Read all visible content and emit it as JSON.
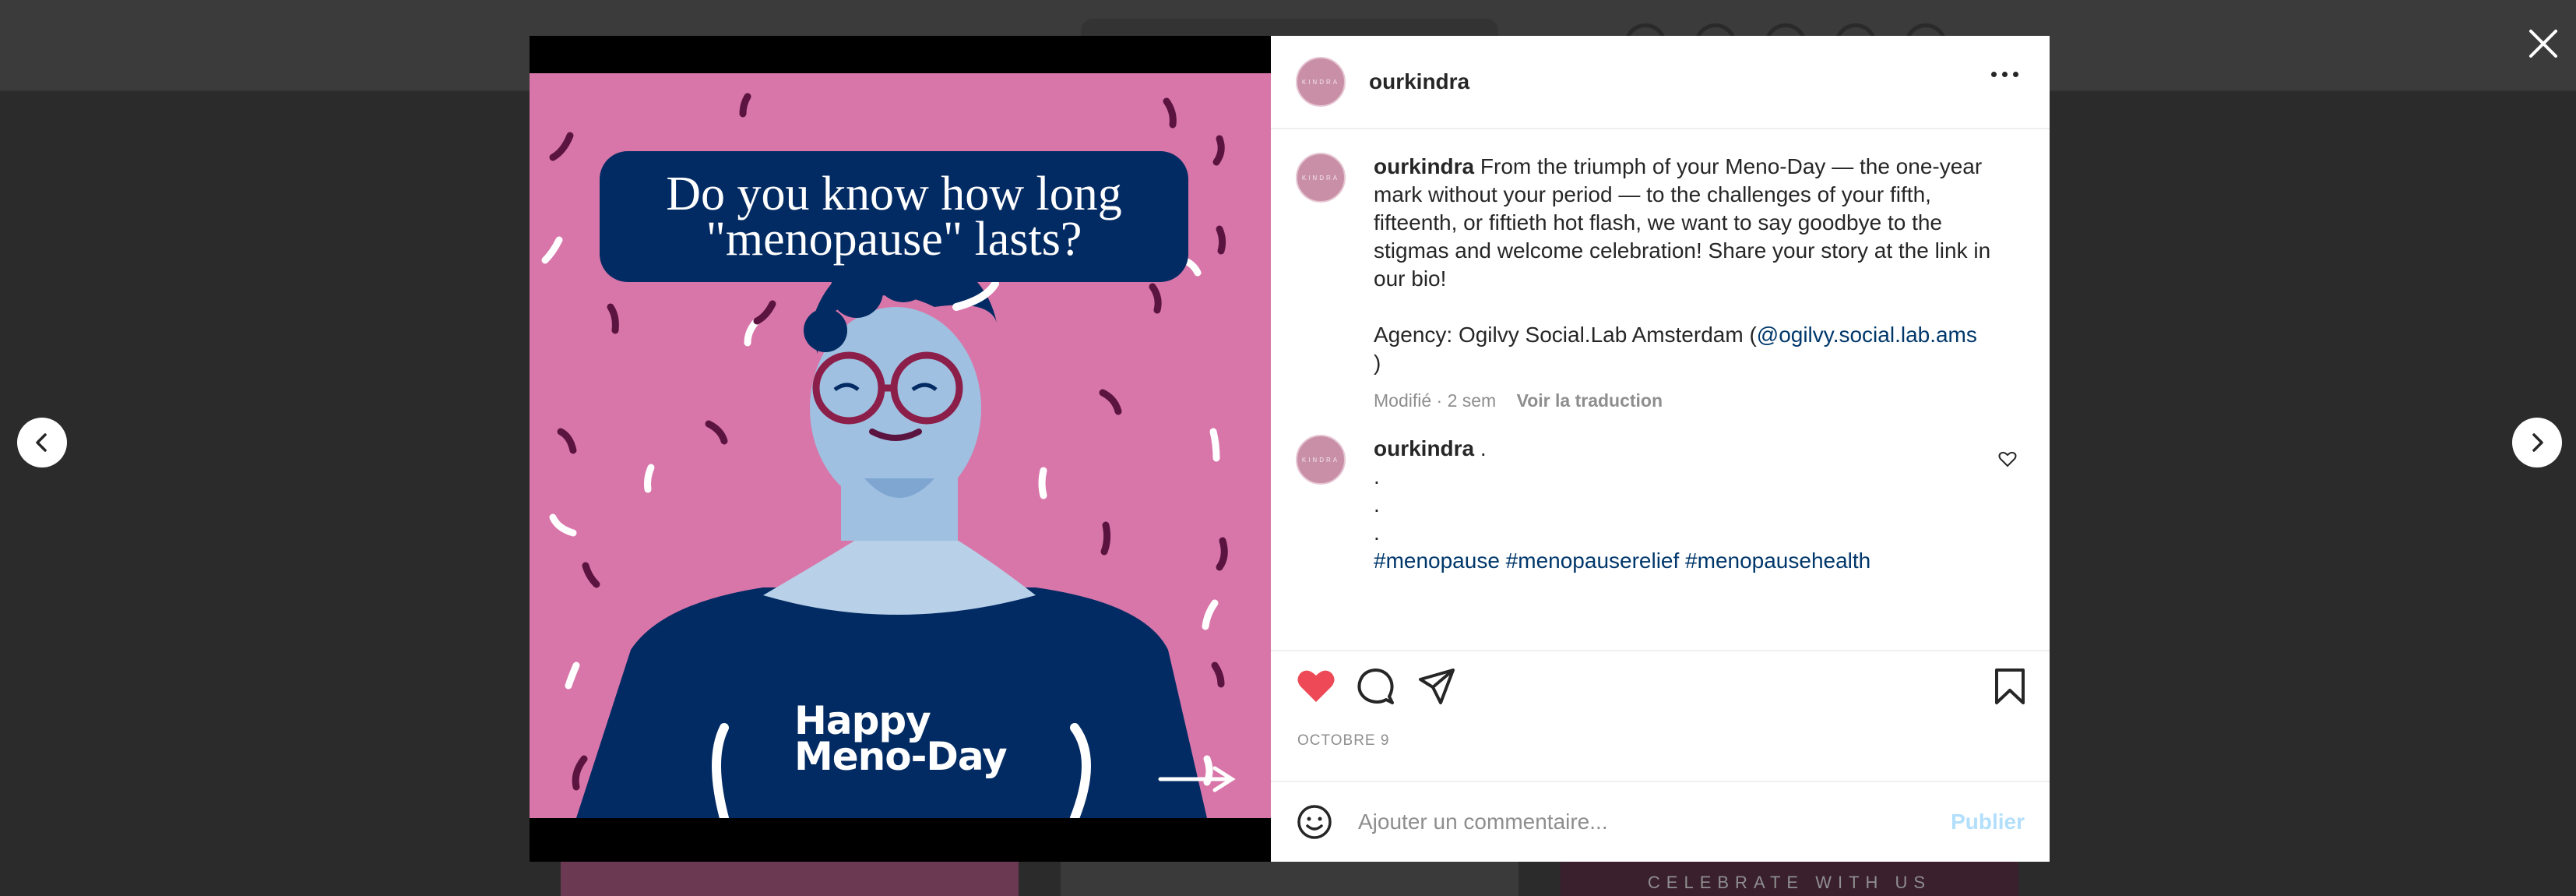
{
  "background": {
    "tile_caption": "CELEBRATE WITH US"
  },
  "post": {
    "headline": "Do you know how long\n\"menopause\" lasts?",
    "shirt_text": "Happy\nMeno-Day",
    "colors": {
      "art_background": "#d876a9",
      "bubble": "#032b63",
      "like_red": "#ed4956",
      "link": "#00376b"
    }
  },
  "panel": {
    "username": "ourkindra",
    "avatar_text": "KINDRA",
    "caption": {
      "username": "ourkindra",
      "text": "From the triumph of your Meno-Day — the one-year mark without your period — to the challenges of your fifth, fifteenth, or fiftieth hot flash, we want to say goodbye to the stigmas and welcome celebration! Share your story at the link in our bio!",
      "agency_prefix": "Agency: Ogilvy Social.Lab Amsterdam (",
      "agency_handle": "@ogilvy.social.lab.ams",
      "agency_suffix": ")",
      "edited": "Modifié · 2 sem",
      "translate": "Voir la traduction"
    },
    "comment": {
      "username": "ourkindra",
      "first_line": ".",
      "dots": [
        ".",
        ".",
        "."
      ],
      "hashtags": "#menopause #menopauserelief #menopausehealth"
    },
    "date": "OCTOBRE 9",
    "comment_placeholder": "Ajouter un commentaire...",
    "publish_label": "Publier"
  },
  "icons": {
    "close": "close-icon",
    "prev": "chevron-left-icon",
    "next": "chevron-right-icon",
    "more": "more-icon",
    "like": "heart-icon",
    "comment": "comment-icon",
    "share": "share-icon",
    "save": "bookmark-icon",
    "emoji": "emoji-icon"
  }
}
